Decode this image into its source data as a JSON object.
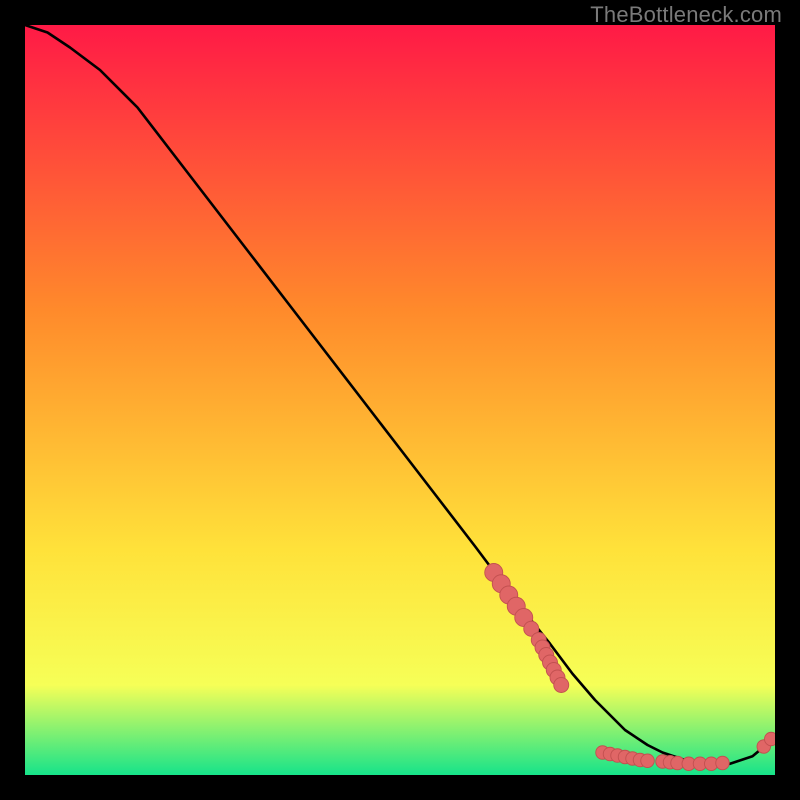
{
  "watermark": "TheBottleneck.com",
  "colors": {
    "page_bg": "#000000",
    "gradient_top": "#ff1a46",
    "gradient_mid1": "#ff8a2b",
    "gradient_mid2": "#ffe23a",
    "gradient_mid3": "#f6ff57",
    "gradient_bottom": "#16e38a",
    "curve": "#000000",
    "marker_fill": "#e06666",
    "marker_stroke": "#c25050"
  },
  "chart_data": {
    "type": "line",
    "title": "",
    "xlabel": "",
    "ylabel": "",
    "xlim": [
      0,
      100
    ],
    "ylim": [
      0,
      100
    ],
    "grid": false,
    "legend": false,
    "series": [
      {
        "name": "bottleneck-curve",
        "x": [
          0,
          3,
          6,
          10,
          15,
          20,
          25,
          30,
          35,
          40,
          45,
          50,
          55,
          60,
          63,
          66,
          70,
          73,
          76,
          80,
          83,
          85,
          88,
          91,
          94,
          97,
          100
        ],
        "y": [
          100,
          99,
          97,
          94,
          89,
          82.5,
          76,
          69.5,
          63,
          56.5,
          50,
          43.5,
          37,
          30.5,
          26.5,
          22.5,
          17.5,
          13.5,
          10,
          6,
          4,
          3,
          2,
          1.5,
          1.5,
          2.5,
          5
        ]
      }
    ],
    "markers": [
      {
        "x": 62.5,
        "y": 27.0,
        "r": 1.2
      },
      {
        "x": 63.5,
        "y": 25.5,
        "r": 1.2
      },
      {
        "x": 64.5,
        "y": 24.0,
        "r": 1.2
      },
      {
        "x": 65.5,
        "y": 22.5,
        "r": 1.2
      },
      {
        "x": 66.5,
        "y": 21.0,
        "r": 1.2
      },
      {
        "x": 67.5,
        "y": 19.5,
        "r": 1.0
      },
      {
        "x": 68.5,
        "y": 18.0,
        "r": 1.0
      },
      {
        "x": 69.0,
        "y": 17.0,
        "r": 1.0
      },
      {
        "x": 69.5,
        "y": 16.0,
        "r": 1.0
      },
      {
        "x": 70.0,
        "y": 15.0,
        "r": 1.0
      },
      {
        "x": 70.5,
        "y": 14.0,
        "r": 1.0
      },
      {
        "x": 71.0,
        "y": 13.0,
        "r": 1.0
      },
      {
        "x": 71.5,
        "y": 12.0,
        "r": 1.0
      },
      {
        "x": 77.0,
        "y": 3.0,
        "r": 0.9
      },
      {
        "x": 78.0,
        "y": 2.8,
        "r": 0.9
      },
      {
        "x": 79.0,
        "y": 2.6,
        "r": 0.9
      },
      {
        "x": 80.0,
        "y": 2.4,
        "r": 0.9
      },
      {
        "x": 81.0,
        "y": 2.2,
        "r": 0.9
      },
      {
        "x": 82.0,
        "y": 2.0,
        "r": 0.9
      },
      {
        "x": 83.0,
        "y": 1.9,
        "r": 0.9
      },
      {
        "x": 85.0,
        "y": 1.8,
        "r": 0.9
      },
      {
        "x": 86.0,
        "y": 1.7,
        "r": 0.9
      },
      {
        "x": 87.0,
        "y": 1.6,
        "r": 0.9
      },
      {
        "x": 88.5,
        "y": 1.5,
        "r": 0.9
      },
      {
        "x": 90.0,
        "y": 1.5,
        "r": 0.9
      },
      {
        "x": 91.5,
        "y": 1.5,
        "r": 0.9
      },
      {
        "x": 93.0,
        "y": 1.6,
        "r": 0.9
      },
      {
        "x": 98.5,
        "y": 3.8,
        "r": 0.9
      },
      {
        "x": 99.5,
        "y": 4.8,
        "r": 0.9
      }
    ]
  }
}
